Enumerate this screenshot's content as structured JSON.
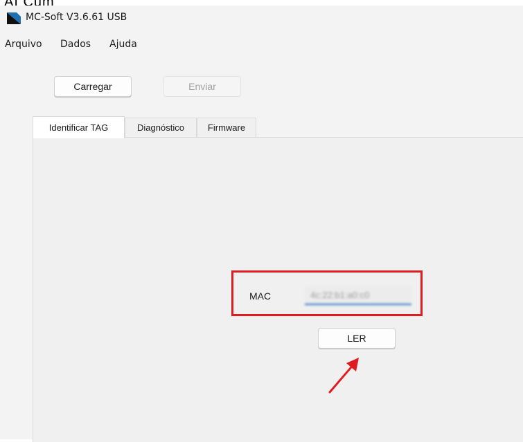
{
  "top_fragment": "AI Cum",
  "window": {
    "title": "MC-Soft V3.6.61 USB",
    "icon": "app-logo-icon"
  },
  "menu": [
    "Arquivo",
    "Dados",
    "Ajuda"
  ],
  "toolbar": {
    "carregar_label": "Carregar",
    "enviar_label": "Enviar"
  },
  "tabs": [
    {
      "label": "Identificar TAG",
      "active": true
    },
    {
      "label": "Diagnóstico",
      "active": false
    },
    {
      "label": "Firmware",
      "active": false
    }
  ],
  "identify": {
    "mac_label": "MAC",
    "mac_value": "4c:22:b1:a0:c0",
    "read_button_label": "LER"
  },
  "colors": {
    "highlight": "#e11b22",
    "input_underline": "#2b6fc4",
    "arrow": "#e11b22",
    "window_bg": "#f3f3f3"
  }
}
